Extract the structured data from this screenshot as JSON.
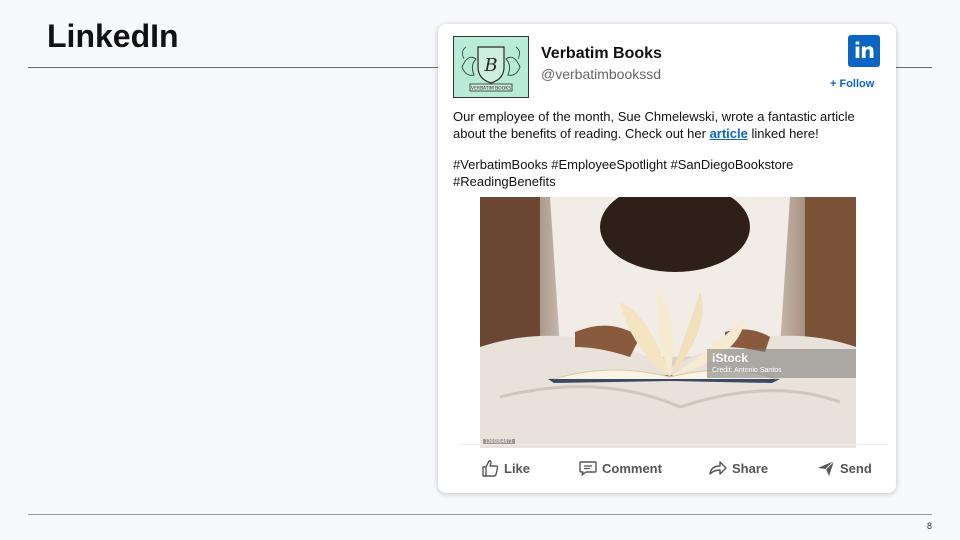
{
  "slide": {
    "title": "LinkedIn",
    "page_number": "8"
  },
  "post": {
    "account_name": "Verbatim Books",
    "account_handle": "@verbatimbookssd",
    "platform_logo_text": "in",
    "follow_label": "+ Follow",
    "text_line1_before_link": "Our employee of the month, Sue Chmelewski, wrote a fantastic article about the benefits of reading. Check out her ",
    "link_text": "article",
    "text_line1_after_link": " linked here!",
    "hashtags": "#VerbatimBooks #EmployeeSpotlight #SanDiegoBookstore #ReadingBenefits",
    "logo_banner_text": "VERBATIM BOOKS",
    "image": {
      "watermark_title": "iStock",
      "watermark_credit": "Credit: Antonio Santos",
      "image_id": "1366864871"
    }
  },
  "actions": {
    "like": "Like",
    "comment": "Comment",
    "share": "Share",
    "send": "Send"
  },
  "colors": {
    "linkedin_blue": "#0a66c2",
    "logo_background": "#b8ecd9"
  }
}
